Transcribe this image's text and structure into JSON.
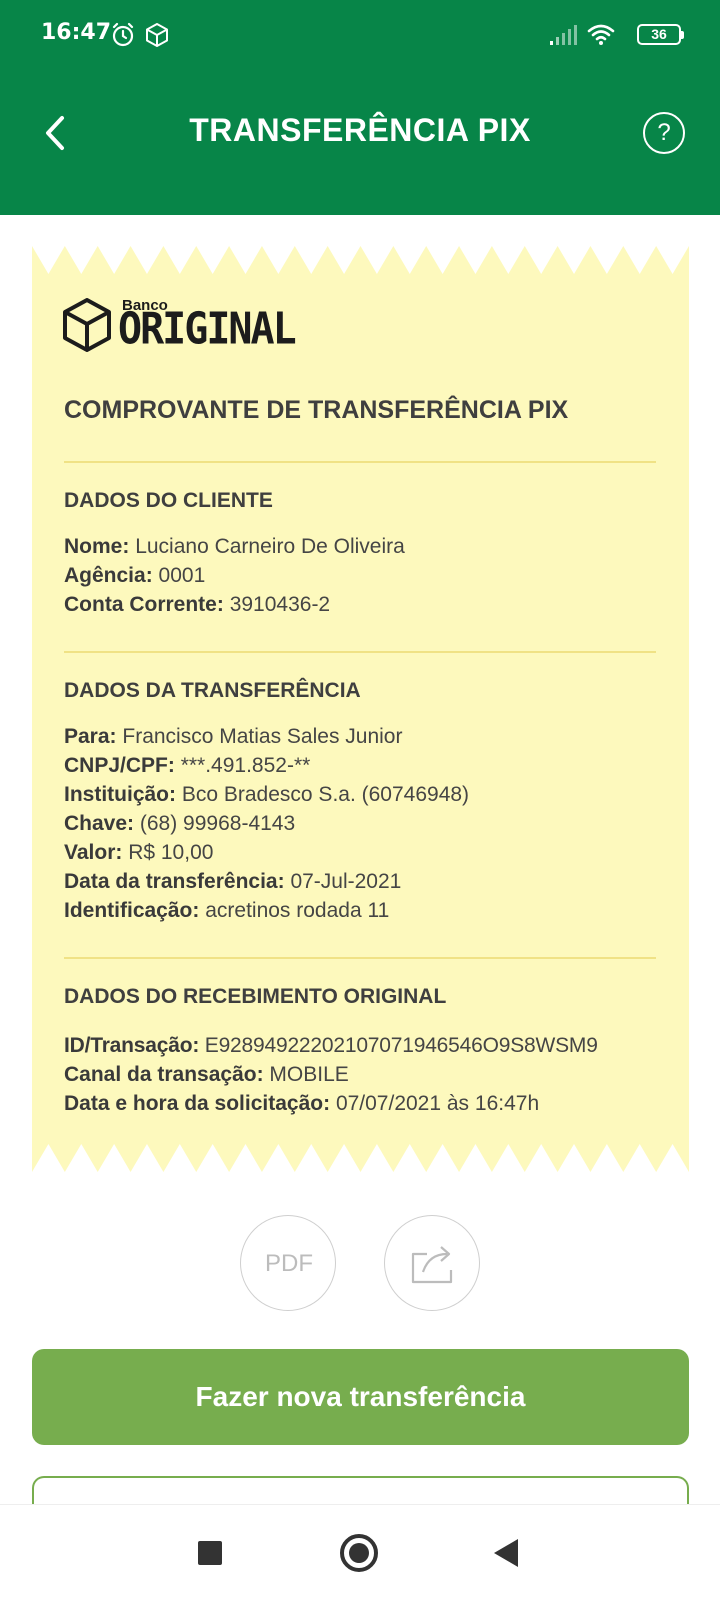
{
  "status_bar": {
    "time": "16:47",
    "battery": "36",
    "icons": [
      "alarm-icon",
      "box-icon",
      "signal-icon",
      "wifi-icon",
      "battery-icon"
    ]
  },
  "header": {
    "title": "TRANSFERÊNCIA PIX",
    "back_icon": "chevron-left-icon",
    "help_label": "?"
  },
  "receipt": {
    "logo": {
      "small": "Banco",
      "big": "ORIGINAL"
    },
    "title": "COMPROVANTE DE TRANSFERÊNCIA PIX",
    "cliente": {
      "heading": "DADOS DO CLIENTE",
      "nome_label": "Nome:",
      "nome_value": "Luciano Carneiro De Oliveira",
      "agencia_label": "Agência:",
      "agencia_value": "0001",
      "conta_label": "Conta Corrente:",
      "conta_value": "3910436-2"
    },
    "transferencia": {
      "heading": "DADOS DA TRANSFERÊNCIA",
      "para_label": "Para:",
      "para_value": "Francisco Matias Sales Junior",
      "cpf_label": "CNPJ/CPF:",
      "cpf_value": "***.491.852-**",
      "inst_label": "Instituição:",
      "inst_value": "Bco Bradesco S.a. (60746948)",
      "chave_label": "Chave:",
      "chave_value": "(68) 99968-4143",
      "valor_label": "Valor:",
      "valor_value": "R$ 10,00",
      "data_label": "Data da transferência:",
      "data_value": "07-Jul-2021",
      "ident_label": "Identificação:",
      "ident_value": "acretinos rodada 11"
    },
    "recebimento": {
      "heading": "DADOS DO RECEBIMENTO ORIGINAL",
      "id_label": "ID/Transação:",
      "id_value": "E92894922202107071946546O9S8WSM9",
      "canal_label": "Canal da transação:",
      "canal_value": "MOBILE",
      "datahora_label": "Data e hora da solicitação:",
      "datahora_value": "07/07/2021 às 16:47h"
    }
  },
  "actions": {
    "pdf_label": "PDF",
    "share_icon": "share-icon",
    "primary_label": "Fazer nova transferência"
  },
  "colors": {
    "header_green": "#078548",
    "receipt_yellow": "#fdf9bd",
    "button_green": "#77ad4e"
  }
}
